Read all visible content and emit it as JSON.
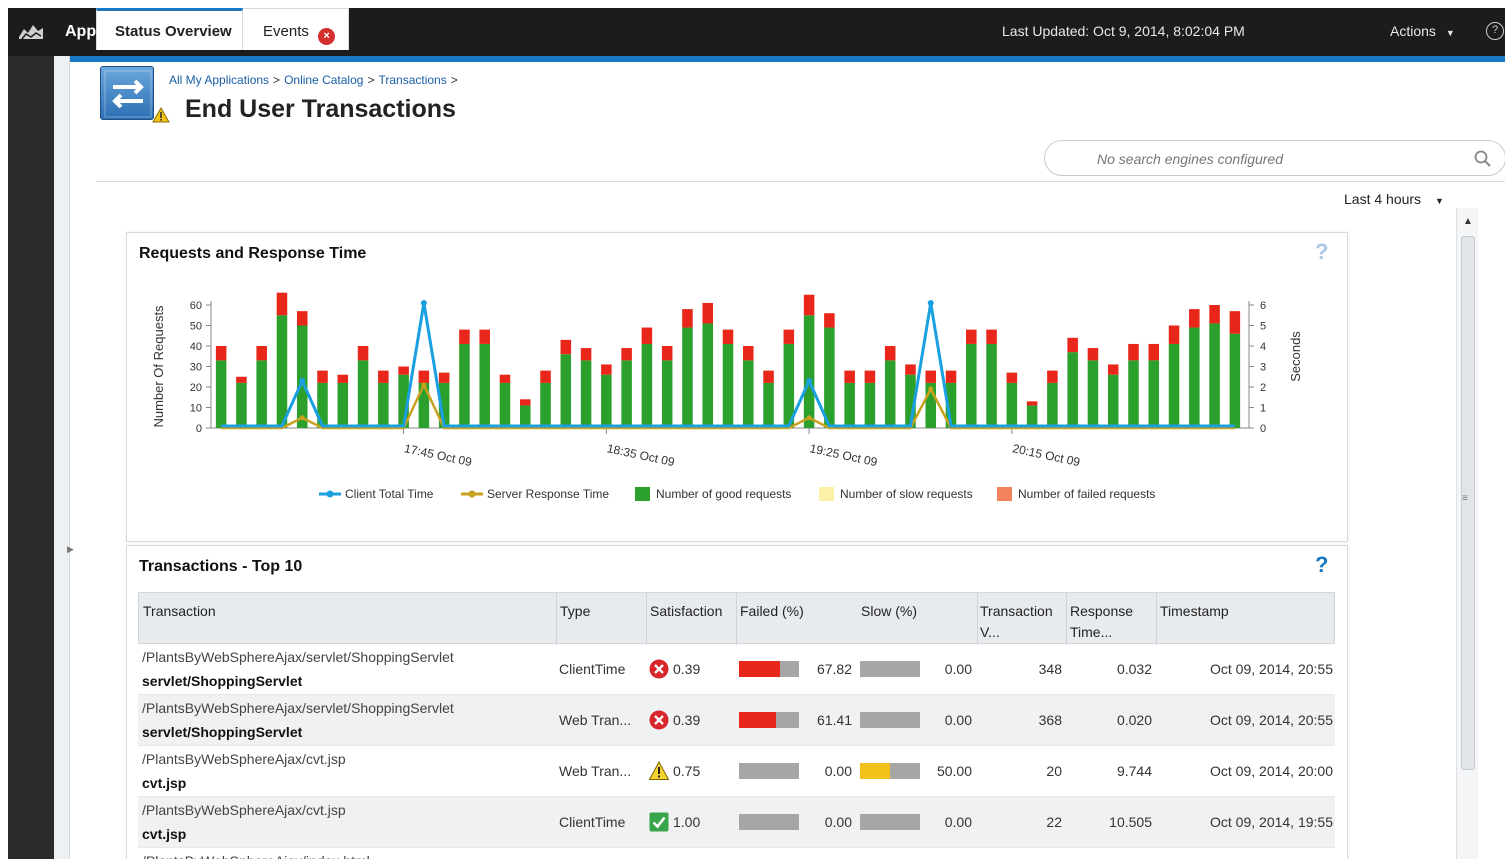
{
  "header": {
    "app_title": "Application Dashboard",
    "last_updated": "Last Updated: Oct 9, 2014, 8:02:04 PM",
    "actions_label": "Actions",
    "help_symbol": "?"
  },
  "breadcrumb": [
    "All My Applications",
    "Online Catalog",
    "Transactions"
  ],
  "breadcrumb_sep": ">",
  "page_title": "End User Transactions",
  "tabs": [
    {
      "label": "Status Overview",
      "active": true
    },
    {
      "label": "Events",
      "badge": "error-icon",
      "active": false
    }
  ],
  "search": {
    "placeholder": "No search engines configured"
  },
  "time_range": "Last 4 hours",
  "colors": {
    "accent": "#1a79c2",
    "good": "#2ca02c",
    "failed": "#e8271a",
    "slow": "#f2c21b",
    "client_line": "#1aa0e0",
    "server_line": "#c8a21f"
  },
  "chart_panel": {
    "title": "Requests and Response Time",
    "help": "?",
    "chart_data": {
      "type": "bar",
      "title": "Requests and Response Time",
      "ylabel": "Number Of Requests",
      "y2label": "Seconds",
      "ylim": [
        0,
        60
      ],
      "y2lim": [
        0,
        6
      ],
      "yticks": [
        "0",
        "10",
        "20",
        "30",
        "40",
        "50",
        "60"
      ],
      "y2ticks": [
        "0",
        "1",
        "2",
        "3",
        "4",
        "5",
        "6"
      ],
      "x_tick_labels": [
        "17:45 Oct 09",
        "18:35 Oct 09",
        "19:25 Oct 09",
        "20:15 Oct 09"
      ],
      "x_tick_index": [
        9,
        19,
        29,
        39
      ],
      "series": [
        {
          "name": "Number of good requests",
          "kind": "bar-stack",
          "values": [
            33,
            22,
            33,
            55,
            50,
            22,
            22,
            33,
            22,
            26,
            22,
            22,
            41,
            41,
            22,
            11,
            22,
            36,
            33,
            26,
            33,
            41,
            33,
            49,
            51,
            41,
            33,
            22,
            41,
            55,
            49,
            22,
            22,
            33,
            26,
            22,
            22,
            41,
            41,
            22,
            11,
            22,
            37,
            33,
            26,
            33,
            33,
            41,
            49,
            51,
            46
          ]
        },
        {
          "name": "Number of slow requests",
          "kind": "bar-stack",
          "values": [
            0,
            0,
            0,
            0,
            0,
            0,
            0,
            0,
            0,
            0,
            0,
            0,
            0,
            0,
            0,
            0,
            0,
            0,
            0,
            0,
            0,
            0,
            0,
            0,
            0,
            0,
            0,
            0,
            0,
            0,
            0,
            0,
            0,
            0,
            0,
            0,
            0,
            0,
            0,
            0,
            0,
            0,
            0,
            0,
            0,
            0,
            0,
            0,
            0,
            0,
            0
          ]
        },
        {
          "name": "Number of failed requests",
          "kind": "bar-stack",
          "values": [
            7,
            3,
            7,
            11,
            7,
            6,
            4,
            7,
            6,
            4,
            6,
            5,
            7,
            7,
            4,
            3,
            6,
            7,
            6,
            5,
            6,
            8,
            7,
            9,
            10,
            7,
            7,
            6,
            7,
            10,
            7,
            6,
            6,
            7,
            5,
            6,
            6,
            7,
            7,
            5,
            2,
            6,
            7,
            6,
            5,
            8,
            8,
            9,
            9,
            9,
            11
          ]
        },
        {
          "name": "Client Total Time",
          "kind": "line",
          "axis": "y2",
          "values": [
            0.1,
            0.1,
            0.1,
            0.1,
            2.3,
            0.1,
            0.1,
            0.1,
            0.1,
            0.1,
            6.1,
            0.1,
            0.1,
            0.1,
            0.1,
            0.1,
            0.1,
            0.1,
            0.1,
            0.1,
            0.1,
            0.1,
            0.1,
            0.1,
            0.1,
            0.1,
            0.1,
            0.1,
            0.1,
            2.3,
            0.1,
            0.1,
            0.1,
            0.1,
            0.1,
            6.1,
            0.1,
            0.1,
            0.1,
            0.1,
            0.1,
            0.1,
            0.1,
            0.1,
            0.1,
            0.1,
            0.1,
            0.1,
            0.1,
            0.1,
            0.1
          ]
        },
        {
          "name": "Server Response Time",
          "kind": "line",
          "axis": "y2",
          "values": [
            0,
            0,
            0,
            0,
            0.5,
            0,
            0,
            0,
            0,
            0,
            2.1,
            0,
            0,
            0,
            0,
            0,
            0,
            0,
            0,
            0,
            0,
            0,
            0,
            0,
            0,
            0,
            0,
            0,
            0,
            0.5,
            0,
            0,
            0,
            0,
            0,
            1.9,
            0,
            0,
            0,
            0,
            0,
            0,
            0,
            0,
            0,
            0,
            0,
            0,
            0,
            0,
            0
          ]
        }
      ],
      "legend": [
        "Client Total Time",
        "Server Response Time",
        "Number of good requests",
        "Number of slow requests",
        "Number of failed requests"
      ],
      "legend_position": "bottom",
      "grid": false
    }
  },
  "table_panel": {
    "title": "Transactions - Top 10",
    "help": "?",
    "columns": [
      {
        "label": "Transaction"
      },
      {
        "label": "Type"
      },
      {
        "label": "Satisfaction"
      },
      {
        "label": "Failed (%)"
      },
      {
        "label": "Slow (%)"
      },
      {
        "label": "Transaction V..."
      },
      {
        "label": "Response Time..."
      },
      {
        "label": "Timestamp"
      }
    ],
    "rows": [
      {
        "path": "/PlantsByWebSphereAjax/servlet/ShoppingServlet",
        "name": "servlet/ShoppingServlet",
        "type": "ClientTime",
        "sat_icon": "error-icon",
        "satisfaction": "0.39",
        "failed": 67.82,
        "failed_label": "67.82",
        "slow": 0,
        "slow_label": "0.00",
        "volume": "348",
        "response": "0.032",
        "timestamp": "Oct 09, 2014, 20:55"
      },
      {
        "path": "/PlantsByWebSphereAjax/servlet/ShoppingServlet",
        "name": "servlet/ShoppingServlet",
        "type": "Web Tran...",
        "sat_icon": "error-icon",
        "satisfaction": "0.39",
        "failed": 61.41,
        "failed_label": "61.41",
        "slow": 0,
        "slow_label": "0.00",
        "volume": "368",
        "response": "0.020",
        "timestamp": "Oct 09, 2014, 20:55"
      },
      {
        "path": "/PlantsByWebSphereAjax/cvt.jsp",
        "name": "cvt.jsp",
        "type": "Web Tran...",
        "sat_icon": "warning-icon",
        "satisfaction": "0.75",
        "failed": 0,
        "failed_label": "0.00",
        "slow": 50,
        "slow_label": "50.00",
        "volume": "20",
        "response": "9.744",
        "timestamp": "Oct 09, 2014, 20:00"
      },
      {
        "path": "/PlantsByWebSphereAjax/cvt.jsp",
        "name": "cvt.jsp",
        "type": "ClientTime",
        "sat_icon": "check-icon",
        "satisfaction": "1.00",
        "failed": 0,
        "failed_label": "0.00",
        "slow": 0,
        "slow_label": "0.00",
        "volume": "22",
        "response": "10.505",
        "timestamp": "Oct 09, 2014, 19:55"
      },
      {
        "path": "/PlantsByWebSphereAjax/index.html",
        "name": "",
        "type": "",
        "sat_icon": "",
        "satisfaction": "",
        "failed": 0,
        "failed_label": "",
        "slow": 0,
        "slow_label": "",
        "volume": "",
        "response": "",
        "timestamp": ""
      }
    ]
  }
}
